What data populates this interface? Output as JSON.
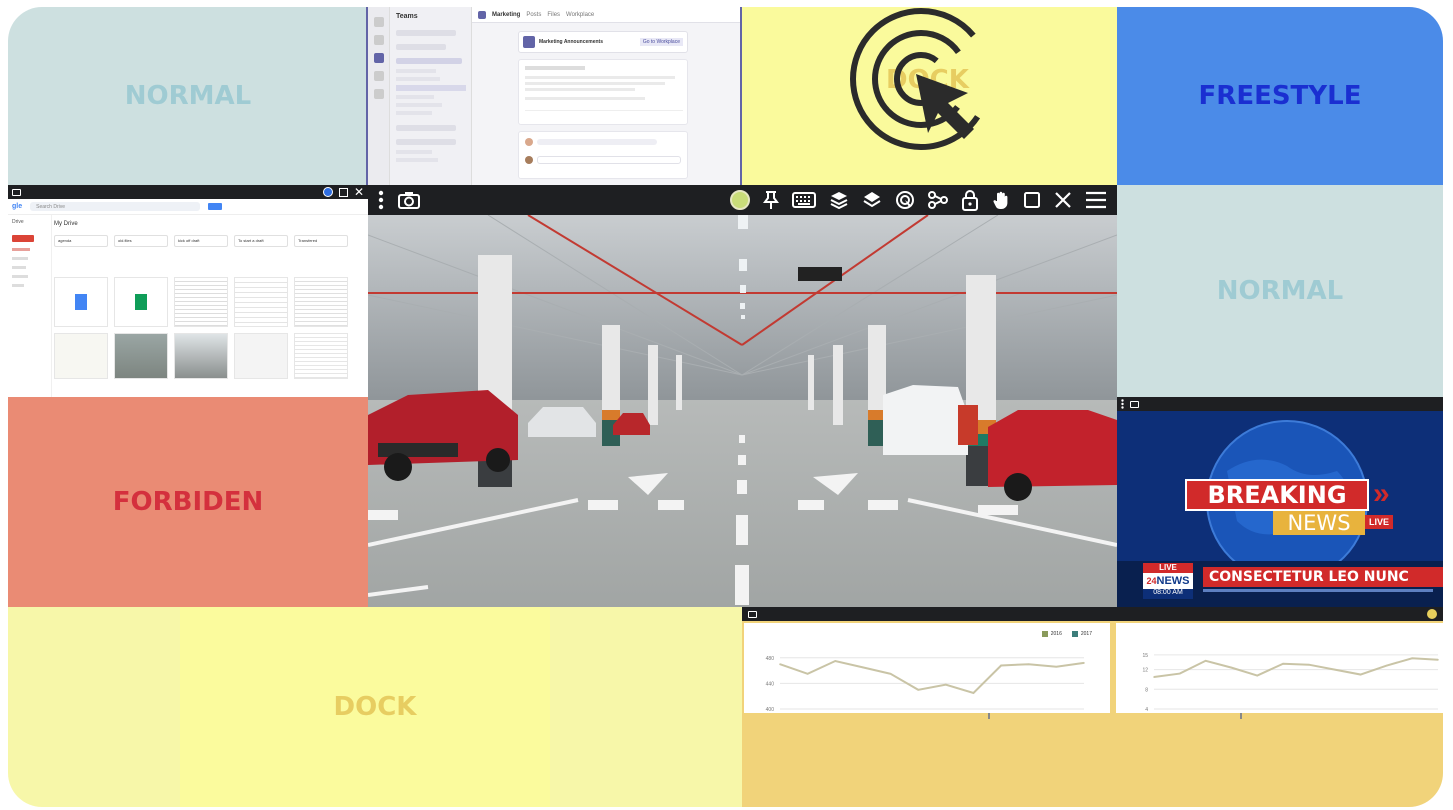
{
  "zones": {
    "normal_top_left": "NORMAL",
    "dock_top": "DOCK",
    "freestyle": "FREESTYLE",
    "normal_right": "NORMAL",
    "forbiden": "FORBIDEN",
    "dock_bottom": "DOCK"
  },
  "colors": {
    "normal_bg": "#cde0e0",
    "normal_text": "#9fcbd3",
    "dock_bg": "#fafa9c",
    "dock_text": "#e7cd61",
    "freestyle_bg": "#4b8be8",
    "freestyle_text": "#1a2fd1",
    "forbiden_bg": "#ea8b74",
    "forbiden_text": "#d4303d",
    "toolbar_bg": "#1e1f22",
    "status_dot": "#c9dc79",
    "news_red": "#d12a2a",
    "news_blue": "#103a8a",
    "chart_panel": "#f1d37a"
  },
  "teams": {
    "app_title": "Teams",
    "channel": "Marketing",
    "tabs": [
      "Posts",
      "Files",
      "Workplace"
    ],
    "post_title": "Marketing Announcements",
    "post_button": "Go to Workplace"
  },
  "drive": {
    "search_placeholder": "Search Drive",
    "section": "My Drive",
    "folders": [
      "agenda",
      "old.files",
      "kick off draft",
      "To start a draft",
      "Transfered"
    ]
  },
  "toolbar": {
    "menu_icon": "vertical-dots-icon",
    "camera_icon": "camera-icon",
    "icons": [
      "pin-icon",
      "keyboard-icon",
      "layers-icon",
      "layers-alt-icon",
      "target-icon",
      "share-icon",
      "lock-icon",
      "hand-icon",
      "window-icon",
      "close-icon",
      "hamburger-icon"
    ]
  },
  "news": {
    "headline_1": "BREAKING",
    "headline_2": "NEWS",
    "live_tag": "LIVE",
    "live_badge": "LIVE",
    "channel": "NEWS",
    "channel_num": "24",
    "time": "08:00 AM",
    "ticker": "CONSECTETUR LEO NUNC"
  },
  "charts": {
    "legend_left": [
      "2016",
      "2017"
    ]
  },
  "chart_data": [
    {
      "type": "line",
      "x": [
        1,
        2,
        3,
        4,
        5,
        6,
        7,
        8,
        9,
        10,
        11,
        12
      ],
      "series": [
        {
          "values": [
            470,
            455,
            475,
            465,
            455,
            430,
            438,
            425,
            468,
            470,
            466,
            472
          ]
        }
      ],
      "ylim": [
        400,
        500
      ],
      "yticks": [
        400,
        440,
        480
      ],
      "grid": true
    },
    {
      "type": "line",
      "x": [
        1,
        2,
        3,
        4,
        5,
        6,
        7,
        8,
        9,
        10,
        11,
        12
      ],
      "series": [
        {
          "values": [
            10.5,
            11.2,
            13.8,
            12.4,
            10.8,
            13.2,
            13.0,
            12.0,
            11.0,
            12.8,
            14.3,
            14.0
          ]
        }
      ],
      "ylim": [
        4,
        17
      ],
      "yticks": [
        4,
        8,
        12,
        15
      ],
      "grid": true
    }
  ]
}
